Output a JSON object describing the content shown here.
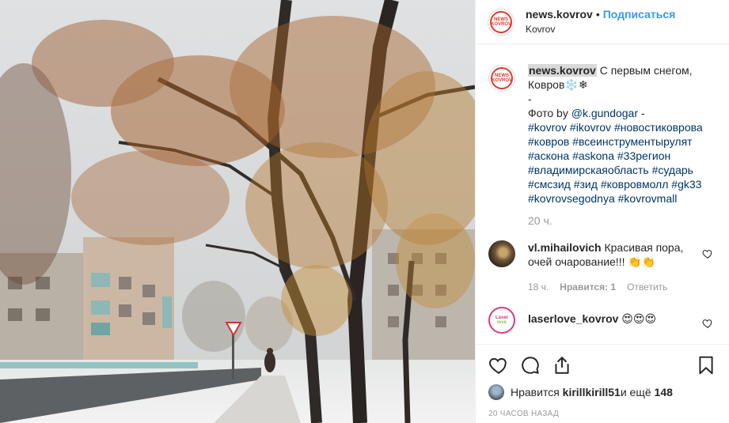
{
  "post": {
    "username": "news.kovrov",
    "follow_label": "Подписаться",
    "dot": "•",
    "location": "Kovrov",
    "avatar_text_top": "NEWS",
    "avatar_text_bottom": "KOVROV"
  },
  "caption": {
    "username": "news.kovrov",
    "text": "С первым снегом, Ковров❄️❄",
    "dash": "-",
    "photo_by_prefix": "Фото by ",
    "photo_by_user": "@k.gundogar",
    "photo_by_suffix": " -",
    "hashtags": [
      "#kovrov",
      "#ikovrov",
      "#новостиковрова",
      "#ковров",
      "#всеинструментырулят",
      "#аскона",
      "#askona",
      "#33регион",
      "#владимирскаяобласть",
      "#сударь",
      "#смсзид",
      "#зид",
      "#ковровмолл",
      "#gk33",
      "#kovrovsegodnya",
      "#kovrovmall"
    ],
    "time": "20 ч."
  },
  "comments": [
    {
      "username": "vl.mihailovich",
      "text": "Красивая пора, очей очарование!!! 👏👏",
      "time": "18 ч.",
      "likes": "Нравится: 1",
      "reply": "Ответить"
    },
    {
      "username": "laserlove_kovrov",
      "text": "😍😍😍",
      "avatar_top": "Laser",
      "avatar_bottom": "love"
    }
  ],
  "footer": {
    "likes_prefix": "Нравится ",
    "likes_user": "kirillkirill51",
    "likes_and": " и ещё ",
    "likes_count": "148",
    "ago": "20 часов назад"
  },
  "colors": {
    "link": "#3897f0",
    "hashtag": "#003569",
    "muted": "#999999"
  }
}
